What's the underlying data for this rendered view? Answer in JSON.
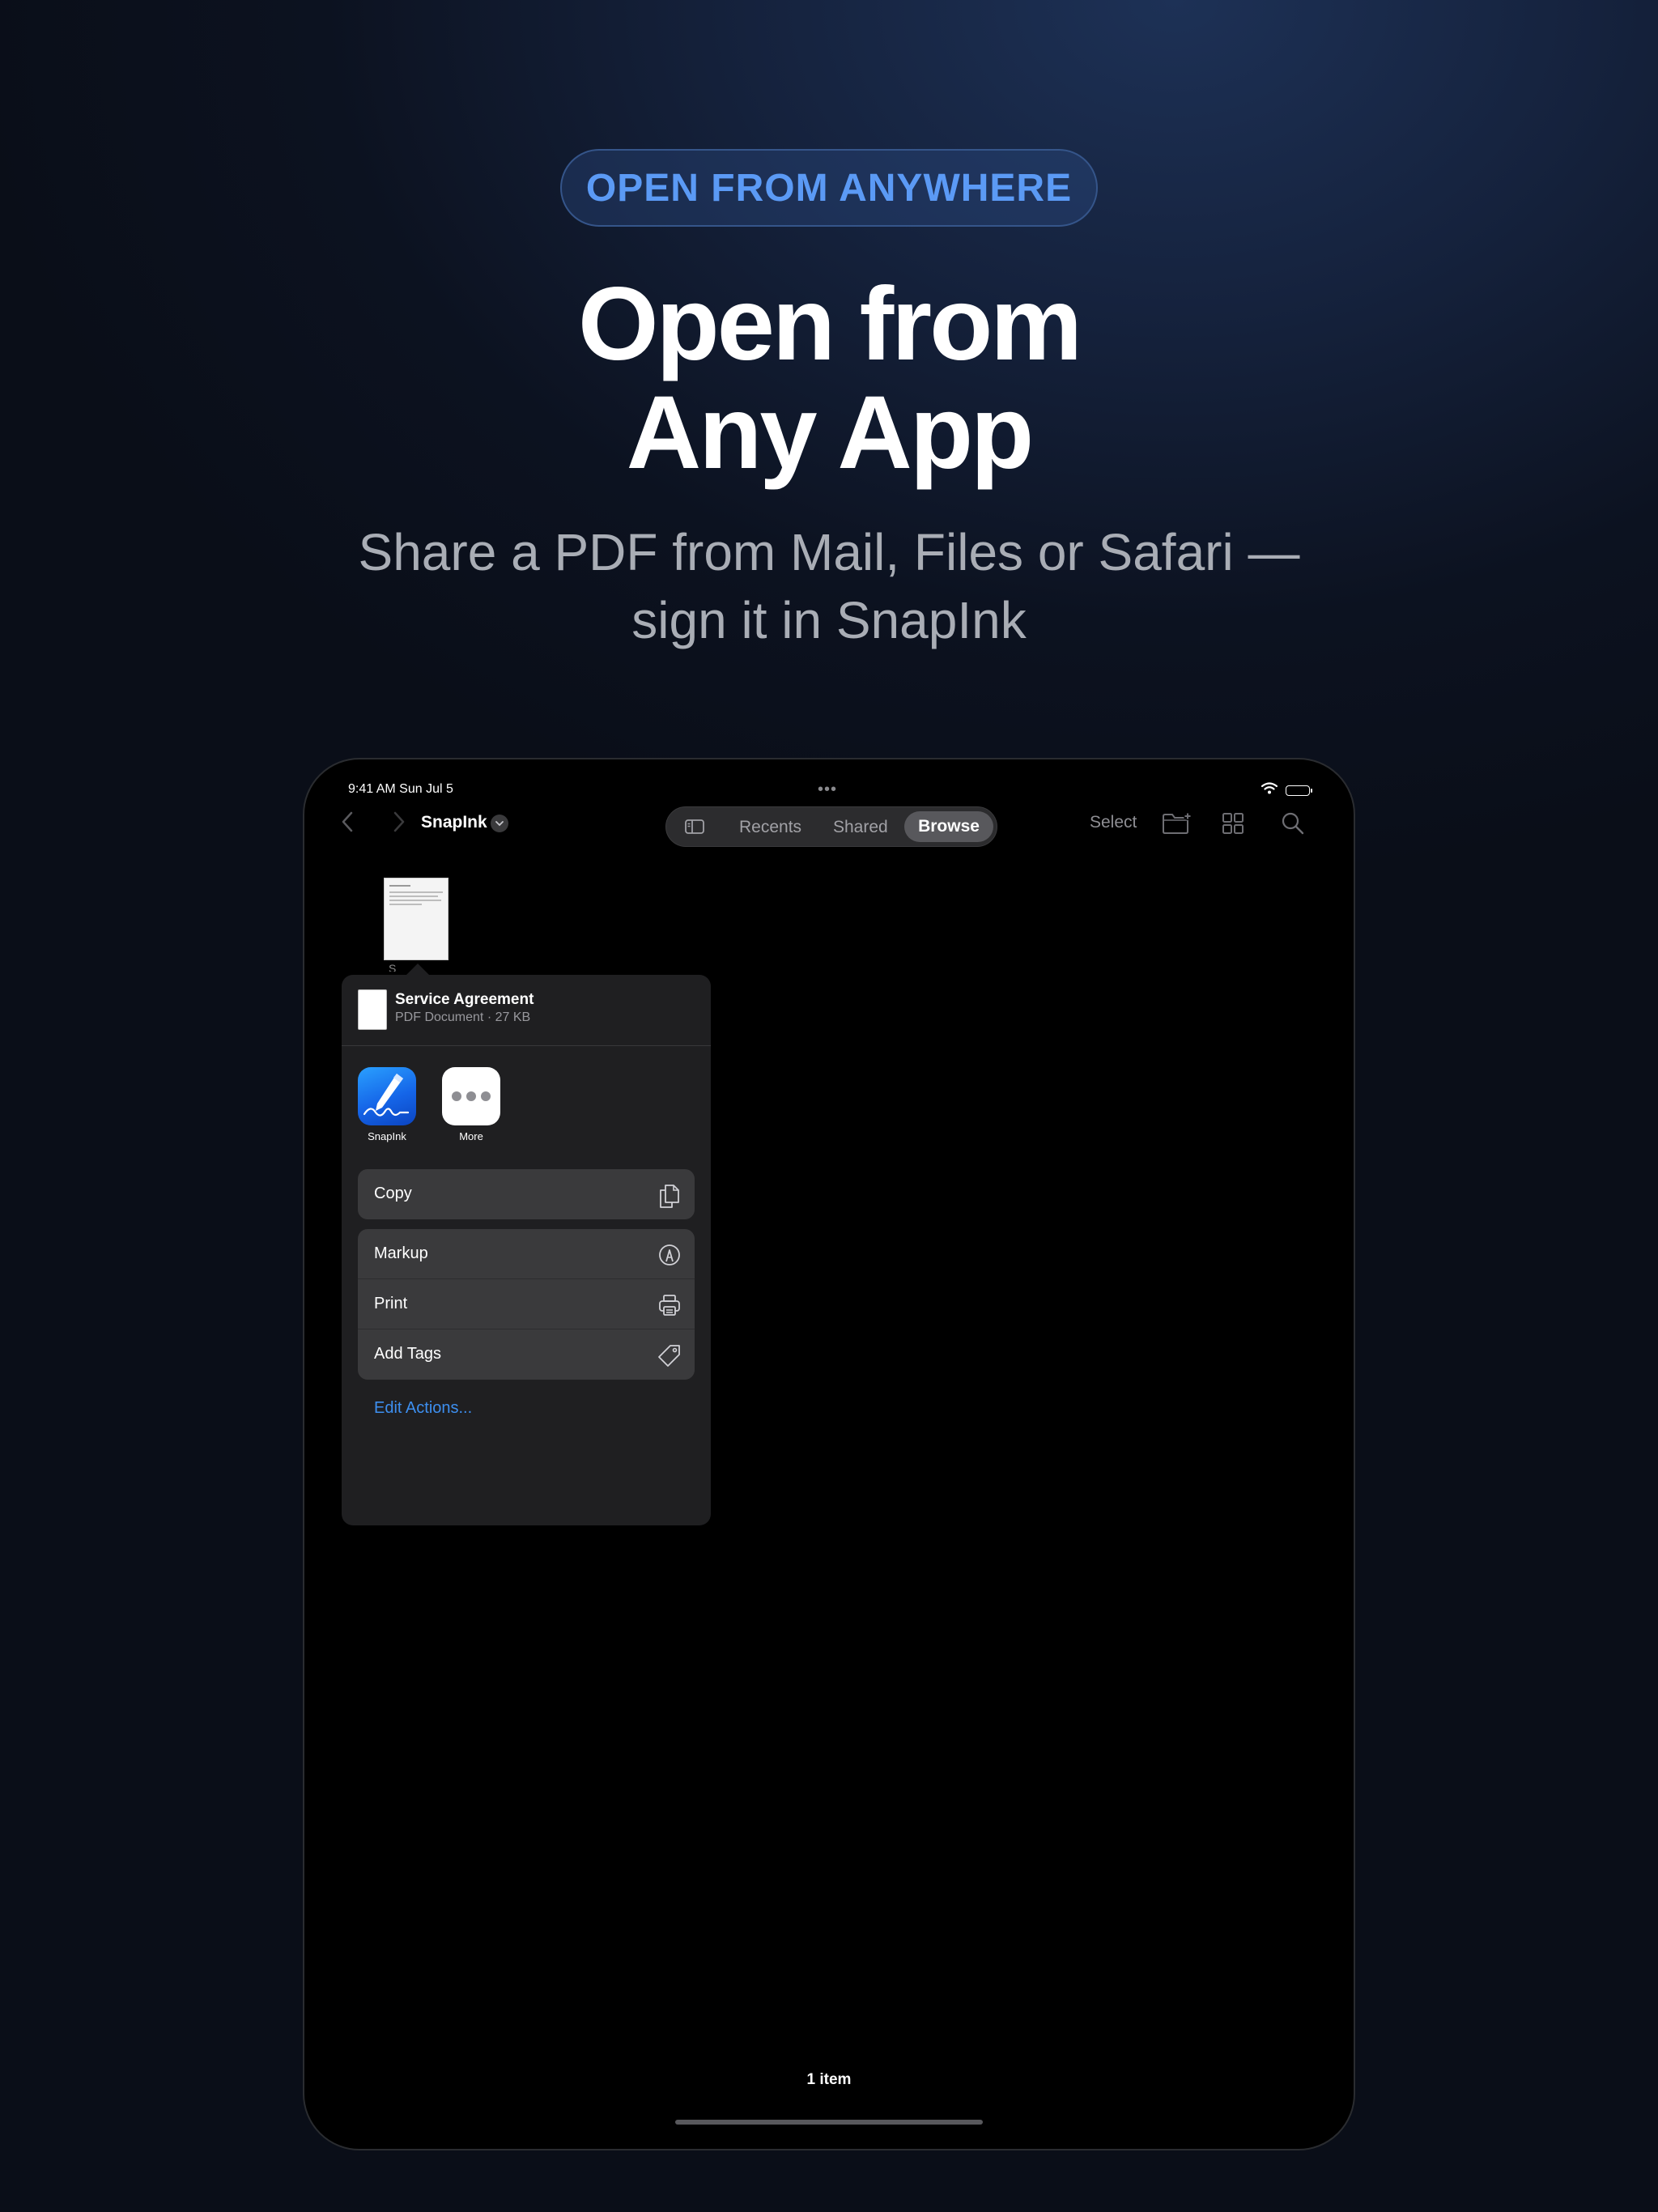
{
  "promo": {
    "badge": "OPEN FROM ANYWHERE",
    "headline_line1": "Open from",
    "headline_line2": "Any App",
    "subtitle_line1": "Share a PDF from Mail, Files or Safari —",
    "subtitle_line2": "sign it in SnapInk"
  },
  "status_bar": {
    "time_date": "9:41 AM   Sun Jul 5",
    "dots": "•••"
  },
  "toolbar": {
    "location": "SnapInk",
    "tabs": [
      "Recents",
      "Shared"
    ],
    "active_tab": "Browse",
    "select_label": "Select",
    "icons": [
      "back-chevron-icon",
      "forward-chevron-icon",
      "sidebar-icon",
      "new-folder-icon",
      "grid-view-icon",
      "search-icon"
    ]
  },
  "file": {
    "label": "S"
  },
  "share_sheet": {
    "file_name": "Service Agreement",
    "file_meta": "PDF Document · 27 KB",
    "apps": [
      {
        "label": "SnapInk",
        "icon": "snapink-app-icon"
      },
      {
        "label": "More",
        "icon": "more-icon"
      }
    ],
    "copy": {
      "label": "Copy",
      "icon": "copy-icon"
    },
    "actions": [
      {
        "label": "Markup",
        "icon": "markup-icon"
      },
      {
        "label": "Print",
        "icon": "printer-icon"
      },
      {
        "label": "Add Tags",
        "icon": "tag-icon"
      }
    ],
    "edit_actions": "Edit Actions..."
  },
  "footer": {
    "items_count": "1 item"
  },
  "colors": {
    "accent_blue": "#3d8ff0",
    "badge_blue": "#5b9af5",
    "device_bg": "#000000",
    "sheet_bg": "#1f1f21",
    "row_bg": "#3a3a3c"
  }
}
